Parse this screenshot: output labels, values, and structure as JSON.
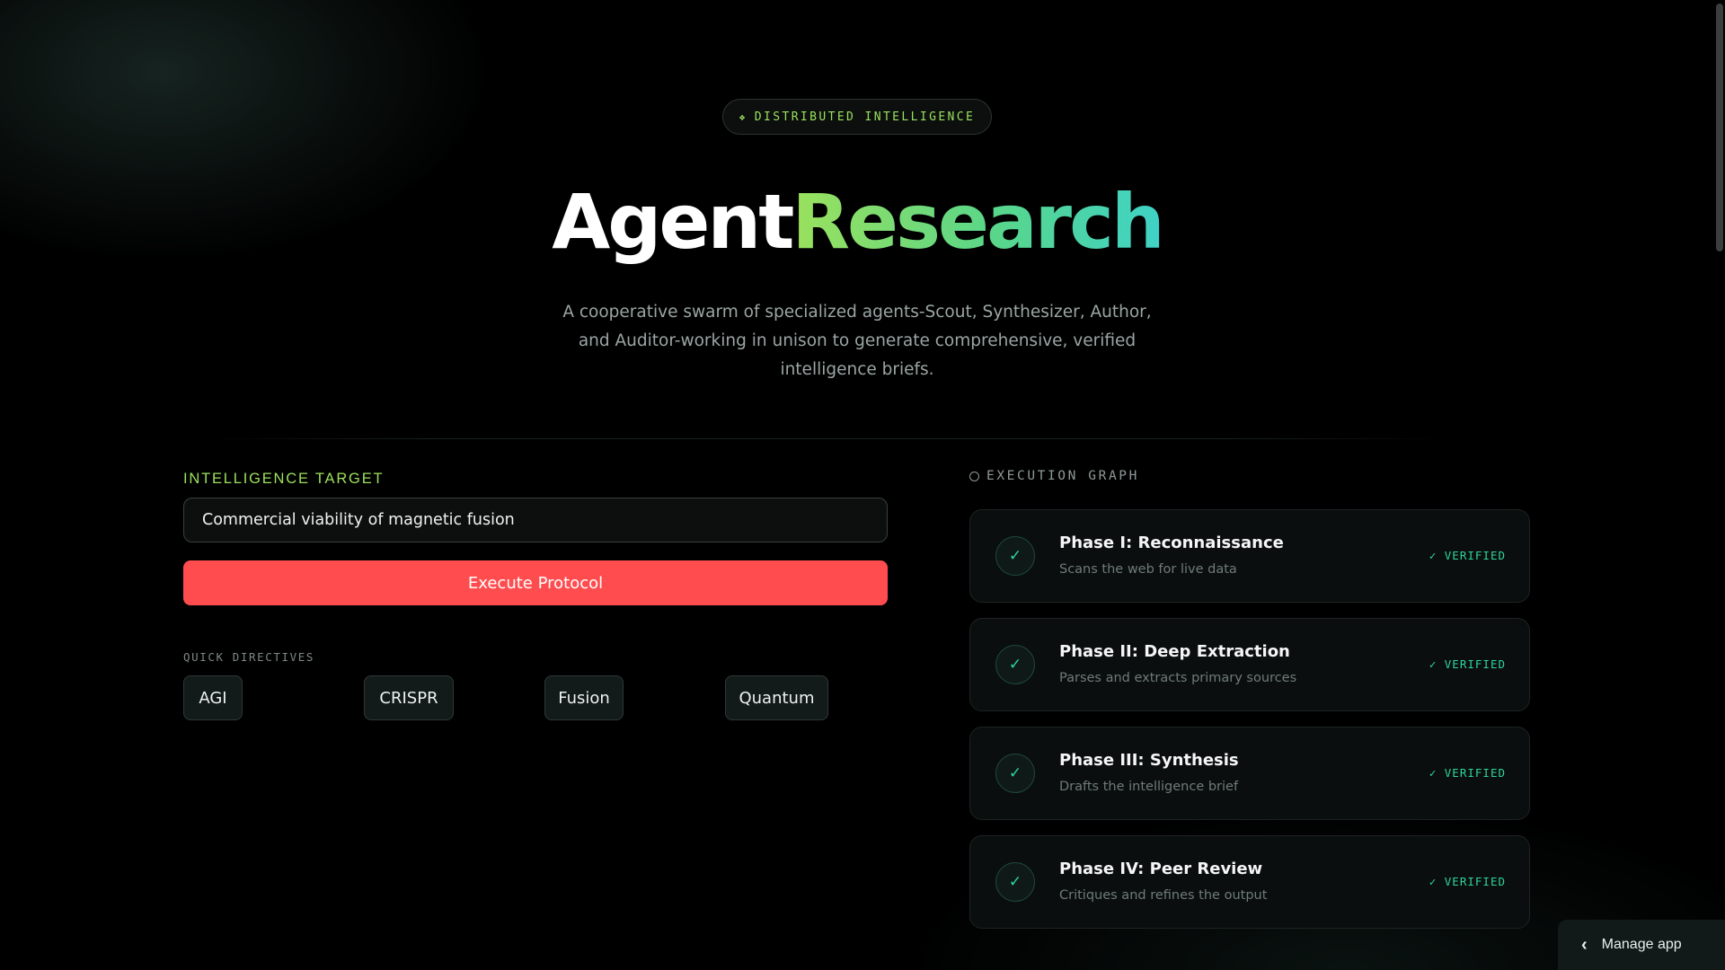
{
  "badge": {
    "icon": "diamond-icon",
    "text": "DISTRIBUTED INTELLIGENCE"
  },
  "hero": {
    "title_part1": "Agent",
    "title_part2": "Research",
    "description": "A cooperative swarm of specialized agents-Scout, Synthesizer, Author, and Auditor-working in unison to generate comprehensive, verified intelligence briefs."
  },
  "target": {
    "label": "INTELLIGENCE TARGET",
    "value": "Commercial viability of magnetic fusion",
    "execute_label": "Execute Protocol"
  },
  "quick": {
    "label": "QUICK DIRECTIVES",
    "chips": [
      "AGI",
      "CRISPR",
      "Fusion",
      "Quantum"
    ]
  },
  "graph": {
    "label": "EXECUTION GRAPH",
    "phases": [
      {
        "title": "Phase I: Reconnaissance",
        "subtitle": "Scans the web for live data",
        "status": "✓ VERIFIED"
      },
      {
        "title": "Phase II: Deep Extraction",
        "subtitle": "Parses and extracts primary sources",
        "status": "✓ VERIFIED"
      },
      {
        "title": "Phase III: Synthesis",
        "subtitle": "Drafts the intelligence brief",
        "status": "✓ VERIFIED"
      },
      {
        "title": "Phase IV: Peer Review",
        "subtitle": "Critiques and refines the output",
        "status": "✓ VERIFIED"
      }
    ]
  },
  "manage_app": {
    "label": "Manage app",
    "icon": "chevron-left-icon"
  },
  "colors": {
    "accent_green": "#9be15d",
    "accent_teal": "#3fd2c7",
    "verified": "#2ed69a",
    "execute_button": "#ff4d4f"
  }
}
